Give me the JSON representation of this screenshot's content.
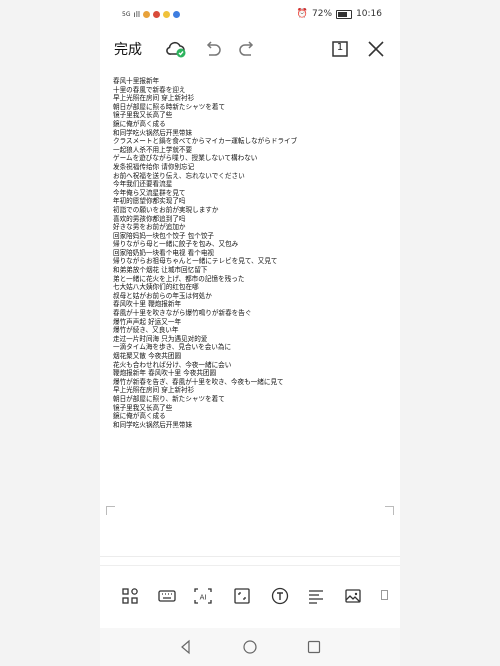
{
  "status_bar": {
    "network": "5G",
    "signal": "ıll",
    "battery_percent": "72%",
    "time": "10:16"
  },
  "toolbar": {
    "done_label": "完成",
    "page_count": "1"
  },
  "lines": [
    "春风十里报新年",
    "十里の春風で新春を迎え",
    "早上光照在房间 穿上新衬衫",
    "朝日が部屋に照る時新たシャツを着て",
    "镜子里我又长高了些",
    "鏡に俺が高く成る",
    "和同学吃火锅然后开黑带妹",
    "クラスメートと鍋を食べてからマイカー運転しながらドライブ",
    "一起狼人杀不用上学就不要",
    "ゲームを遊びながら喋り、授業しないて構わない",
    "发条祝福传给你 请你别忘记",
    "お前へ祝福を送り伝え、忘れないでください",
    "今年我们还要看流星",
    "今年俺ら又流星群を見て",
    "年初的愿望你都实现了吗",
    "初詣での願いをお前が実現しますか",
    "喜欢的男孩你都追到了吗",
    "好きな男をお前が追加か",
    "回家陪妈妈一块包个饺子 包个饺子",
    "帰りながら母と一緒に餃子を包み、又包み",
    "回家陪奶奶一块看个电视 看个电视",
    "帰りながらお祖母ちゃんと一緒にテレビを見て、又見て",
    "和弟弟放个烟花 让城市回忆留下",
    "弟と一緒に花火を上げ、都市の記憶を残った",
    "七大姑八大姨你们的红包在哪",
    "叔母と姑がお前らの年玉は何処か",
    "春风吹十里 鞭炮报新年",
    "春風が十里を吹きながら爆竹鳴りが新春を告ぐ",
    "爆竹声声起 好运又一年",
    "爆竹が続き、又良い年",
    "走过一片时间海 只为遇见对的爱",
    "一滴タイム海を歩き、見合いを会い為に",
    "烟花聚又散 今夜共团圆",
    "花火も合わせれば分け、今夜一緒に会い",
    "鞭炮报新年 春风吹十里 今夜共团圆",
    "爆竹が新春を告ぎ、春風が十里を吹き、今夜も一緒に見て",
    "早上光照在房间 穿上新衬衫",
    "朝日が部屋に照り、新たシャツを着て",
    "镜子里我又长高了些",
    "鏡に俺が高く成る",
    "和同学吃火锅然后开黑带妹"
  ],
  "icons": {
    "status": [
      "notification-icon",
      "notification-icon",
      "notification-icon",
      "notification-icon",
      "alarm-icon",
      "battery-icon"
    ],
    "toolbar": [
      "cloud-sync-icon",
      "undo-icon",
      "redo-icon",
      "page-count-icon",
      "close-icon"
    ],
    "bottom": [
      "grid-icon",
      "keyboard-icon",
      "ai-icon",
      "crop-icon",
      "text-style-icon",
      "align-icon",
      "image-icon"
    ],
    "nav": [
      "back-icon",
      "home-icon",
      "recent-apps-icon"
    ]
  },
  "colors": {
    "accent_green": "#2db35d",
    "text": "#111111"
  }
}
